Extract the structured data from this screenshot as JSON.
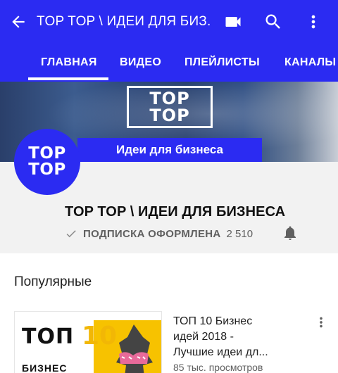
{
  "toolbar": {
    "title": "TOP TOP \\ ИДЕИ ДЛЯ БИЗ...",
    "icons": [
      "back-arrow-icon",
      "video-camera-icon",
      "search-icon",
      "more-vert-icon"
    ]
  },
  "tabs": [
    {
      "label": "ГЛАВНАЯ",
      "selected": true
    },
    {
      "label": "ВИДЕО",
      "selected": false
    },
    {
      "label": "ПЛЕЙЛИСТЫ",
      "selected": false
    },
    {
      "label": "КАНАЛЫ",
      "selected": false
    }
  ],
  "banner": {
    "logo_line1": "TOP",
    "logo_line2": "TOP",
    "strip_text": "Идеи для бизнеса"
  },
  "channel": {
    "avatar_line1": "TOP",
    "avatar_line2": "TOP",
    "name": "TOP TOP \\ ИДЕИ ДЛЯ БИЗНЕСА",
    "subscribe_label": "ПОДПИСКА ОФОРМЛЕНА",
    "subscriber_count": "2 510"
  },
  "section": {
    "title": "Популярные"
  },
  "videos": [
    {
      "thumb_top": "ТОП",
      "thumb_num": "10",
      "thumb_biz": "БИЗНЕС",
      "title_lines": [
        "ТОП 10 Бизнес",
        "идей 2018 -",
        "Лучшие идеи дл..."
      ],
      "meta": "85 тыс. просмотров"
    }
  ],
  "colors": {
    "accent": "#2b2bf2",
    "background": "#ffffff",
    "channel_bg": "#f2f2f2",
    "secondary_text": "#606060"
  }
}
